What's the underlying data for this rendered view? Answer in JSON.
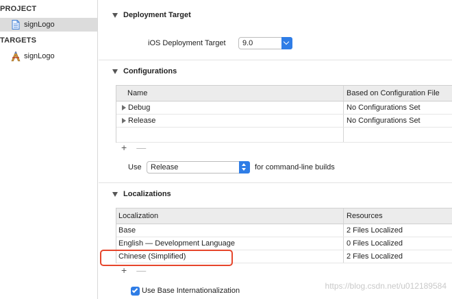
{
  "sidebar": {
    "project_header": "PROJECT",
    "project_item": "signLogo",
    "targets_header": "TARGETS",
    "target_item": "signLogo"
  },
  "deployment": {
    "title": "Deployment Target",
    "label": "iOS Deployment Target",
    "value": "9.0"
  },
  "configurations": {
    "title": "Configurations",
    "columns": [
      "Name",
      "Based on Configuration File"
    ],
    "rows": [
      {
        "name": "Debug",
        "file": "No Configurations Set"
      },
      {
        "name": "Release",
        "file": "No Configurations Set"
      }
    ],
    "use_label": "Use",
    "use_value": "Release",
    "use_suffix": "for command-line builds"
  },
  "localizations": {
    "title": "Localizations",
    "columns": [
      "Localization",
      "Resources"
    ],
    "rows": [
      {
        "name": "Base",
        "resources": "2 Files Localized"
      },
      {
        "name": "English — Development Language",
        "resources": "0 Files Localized"
      },
      {
        "name": "Chinese (Simplified)",
        "resources": "2 Files Localized"
      }
    ],
    "checkbox_label": "Use Base Internationalization",
    "checkbox_checked": true
  },
  "watermark": "https://blog.csdn.net/u012189584",
  "colors": {
    "accent": "#2f7de6",
    "highlight": "#e6452b"
  },
  "icons": {
    "plus": "+",
    "minus": "—"
  }
}
